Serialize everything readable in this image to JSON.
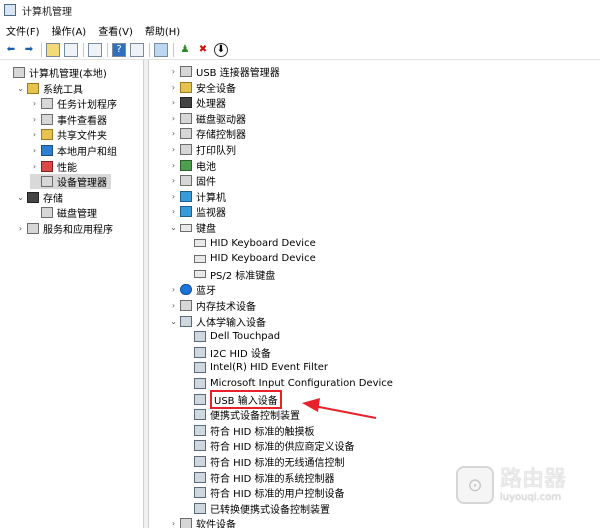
{
  "window": {
    "title": "计算机管理"
  },
  "menu": [
    "文件(F)",
    "操作(A)",
    "查看(V)",
    "帮助(H)"
  ],
  "left_tree": [
    {
      "label": "计算机管理(本地)",
      "level": 0,
      "chev": "",
      "icon": "computer-management-icon"
    },
    {
      "label": "系统工具",
      "level": 1,
      "chev": "⌄",
      "icon": "tools-icon"
    },
    {
      "label": "任务计划程序",
      "level": 2,
      "chev": "›",
      "icon": "clock-icon"
    },
    {
      "label": "事件查看器",
      "level": 2,
      "chev": "›",
      "icon": "event-viewer-icon"
    },
    {
      "label": "共享文件夹",
      "level": 2,
      "chev": "›",
      "icon": "shared-folder-icon"
    },
    {
      "label": "本地用户和组",
      "level": 2,
      "chev": "›",
      "icon": "users-icon"
    },
    {
      "label": "性能",
      "level": 2,
      "chev": "›",
      "icon": "performance-icon"
    },
    {
      "label": "设备管理器",
      "level": 2,
      "chev": "",
      "icon": "device-manager-icon",
      "selected": true
    },
    {
      "label": "存储",
      "level": 1,
      "chev": "⌄",
      "icon": "storage-icon"
    },
    {
      "label": "磁盘管理",
      "level": 2,
      "chev": "",
      "icon": "disk-icon"
    },
    {
      "label": "服务和应用程序",
      "level": 1,
      "chev": "›",
      "icon": "services-icon"
    }
  ],
  "device_tree": [
    {
      "label": "USB 连接器管理器",
      "level": 1,
      "chev": "›",
      "icon": "usb-connector-icon"
    },
    {
      "label": "安全设备",
      "level": 1,
      "chev": "›",
      "icon": "security-device-icon"
    },
    {
      "label": "处理器",
      "level": 1,
      "chev": "›",
      "icon": "processor-icon"
    },
    {
      "label": "磁盘驱动器",
      "level": 1,
      "chev": "›",
      "icon": "disk-drive-icon"
    },
    {
      "label": "存储控制器",
      "level": 1,
      "chev": "›",
      "icon": "storage-controller-icon"
    },
    {
      "label": "打印队列",
      "level": 1,
      "chev": "›",
      "icon": "printer-icon"
    },
    {
      "label": "电池",
      "level": 1,
      "chev": "›",
      "icon": "battery-icon"
    },
    {
      "label": "固件",
      "level": 1,
      "chev": "›",
      "icon": "firmware-icon"
    },
    {
      "label": "计算机",
      "level": 1,
      "chev": "›",
      "icon": "computer-icon"
    },
    {
      "label": "监视器",
      "level": 1,
      "chev": "›",
      "icon": "monitor-icon"
    },
    {
      "label": "键盘",
      "level": 1,
      "chev": "⌄",
      "icon": "keyboard-icon"
    },
    {
      "label": "HID Keyboard Device",
      "level": 2,
      "chev": "",
      "icon": "keyboard-icon"
    },
    {
      "label": "HID Keyboard Device",
      "level": 2,
      "chev": "",
      "icon": "keyboard-icon"
    },
    {
      "label": "PS/2 标准键盘",
      "level": 2,
      "chev": "",
      "icon": "keyboard-icon"
    },
    {
      "label": "蓝牙",
      "level": 1,
      "chev": "›",
      "icon": "bluetooth-icon"
    },
    {
      "label": "内存技术设备",
      "level": 1,
      "chev": "›",
      "icon": "memory-device-icon"
    },
    {
      "label": "人体学输入设备",
      "level": 1,
      "chev": "⌄",
      "icon": "hid-icon"
    },
    {
      "label": "Dell Touchpad",
      "level": 2,
      "chev": "",
      "icon": "hid-icon"
    },
    {
      "label": "I2C HID 设备",
      "level": 2,
      "chev": "",
      "icon": "hid-icon"
    },
    {
      "label": "Intel(R) HID Event Filter",
      "level": 2,
      "chev": "",
      "icon": "hid-icon"
    },
    {
      "label": "Microsoft Input Configuration Device",
      "level": 2,
      "chev": "",
      "icon": "hid-icon"
    },
    {
      "label": "USB 输入设备",
      "level": 2,
      "chev": "",
      "icon": "hid-icon",
      "highlight": true
    },
    {
      "label": "便携式设备控制装置",
      "level": 2,
      "chev": "",
      "icon": "hid-icon"
    },
    {
      "label": "符合 HID 标准的触摸板",
      "level": 2,
      "chev": "",
      "icon": "hid-icon"
    },
    {
      "label": "符合 HID 标准的供应商定义设备",
      "level": 2,
      "chev": "",
      "icon": "hid-icon"
    },
    {
      "label": "符合 HID 标准的无线通信控制",
      "level": 2,
      "chev": "",
      "icon": "hid-icon"
    },
    {
      "label": "符合 HID 标准的系统控制器",
      "level": 2,
      "chev": "",
      "icon": "hid-icon"
    },
    {
      "label": "符合 HID 标准的用户控制设备",
      "level": 2,
      "chev": "",
      "icon": "hid-icon"
    },
    {
      "label": "已转换便携式设备控制装置",
      "level": 2,
      "chev": "",
      "icon": "hid-icon"
    },
    {
      "label": "软件设备",
      "level": 1,
      "chev": "›",
      "icon": "software-device-icon"
    }
  ],
  "watermark": {
    "name": "路由器",
    "url": "luyouqi.com"
  },
  "colors": {
    "highlight": "#e8212a",
    "selected": "#d9d9d9"
  }
}
